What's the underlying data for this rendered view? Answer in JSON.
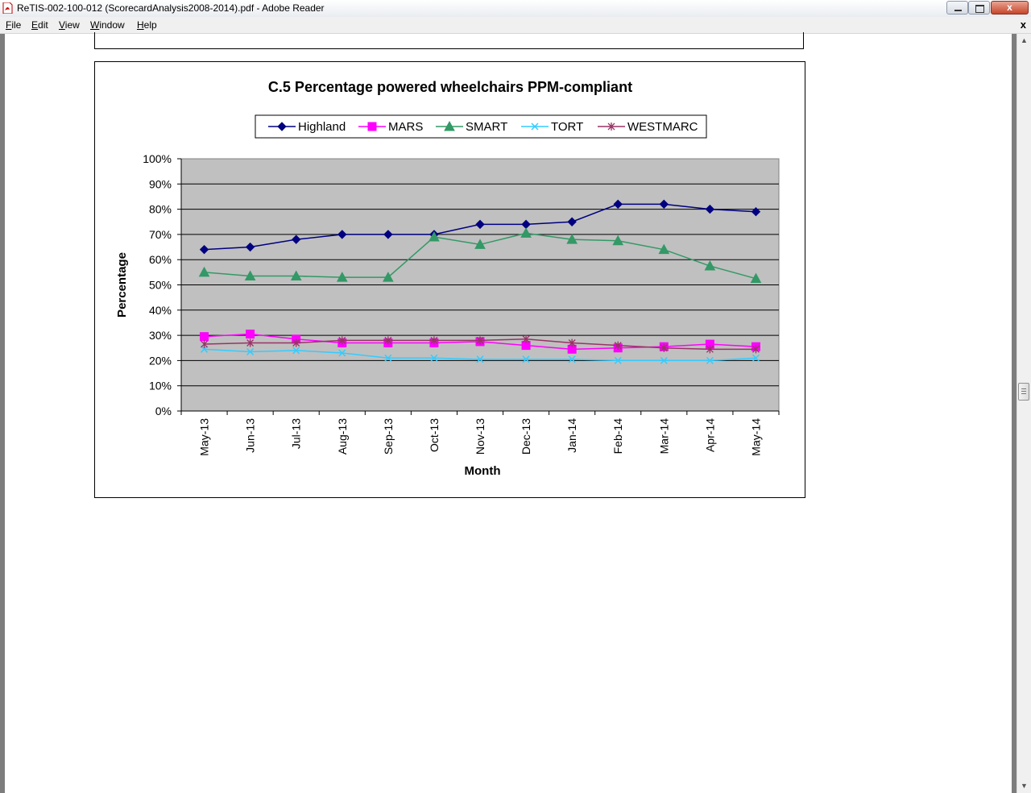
{
  "window": {
    "title": "ReTIS-002-100-012 (ScorecardAnalysis2008-2014).pdf - Adobe Reader",
    "close_glyph": "x"
  },
  "menu": {
    "items": [
      "File",
      "Edit",
      "View",
      "Window",
      "Help"
    ],
    "close_glyph": "x"
  },
  "icons": {
    "app": "pdf-document-icon",
    "minimize": "minimize-icon",
    "maximize": "maximize-icon",
    "close": "close-icon",
    "scroll_up": "scroll-up-arrow-icon",
    "scroll_down": "scroll-down-arrow-icon"
  },
  "scrollbar": {
    "position": 0.47
  },
  "chart_data": {
    "type": "line",
    "title": "C.5 Percentage powered wheelchairs PPM-compliant",
    "xlabel": "Month",
    "ylabel": "Percentage",
    "ylim": [
      0,
      100
    ],
    "yticks": [
      "0%",
      "10%",
      "20%",
      "30%",
      "40%",
      "50%",
      "60%",
      "70%",
      "80%",
      "90%",
      "100%"
    ],
    "grid": true,
    "plot_background": "#c0c0c0",
    "legend_position": "top",
    "categories": [
      "May-13",
      "Jun-13",
      "Jul-13",
      "Aug-13",
      "Sep-13",
      "Oct-13",
      "Nov-13",
      "Dec-13",
      "Jan-14",
      "Feb-14",
      "Mar-14",
      "Apr-14",
      "May-14"
    ],
    "series": [
      {
        "name": "Highland",
        "color": "#000080",
        "marker": "diamond",
        "values": [
          64,
          65,
          68,
          70,
          70,
          70,
          74,
          74,
          75,
          82,
          82,
          80,
          79
        ]
      },
      {
        "name": "MARS",
        "color": "#ff00ff",
        "marker": "square",
        "values": [
          29.5,
          30.5,
          28.5,
          27,
          27,
          27,
          27.5,
          26,
          24.5,
          25,
          25.5,
          26.5,
          25.5
        ]
      },
      {
        "name": "SMART",
        "color": "#339966",
        "marker": "triangle",
        "values": [
          55,
          53.5,
          53.5,
          53,
          53,
          69,
          66,
          70.5,
          68,
          67.5,
          64,
          57.5,
          52.5
        ]
      },
      {
        "name": "TORT",
        "color": "#33ccff",
        "marker": "x",
        "values": [
          24.5,
          23.5,
          24,
          23,
          21,
          21,
          20.5,
          20.5,
          20.5,
          20,
          20,
          20,
          21
        ]
      },
      {
        "name": "WESTMARC",
        "color": "#993366",
        "marker": "star",
        "values": [
          26.5,
          27,
          27,
          28,
          28,
          28,
          28,
          28.5,
          27,
          26,
          25,
          24.5,
          24.5
        ]
      }
    ]
  }
}
